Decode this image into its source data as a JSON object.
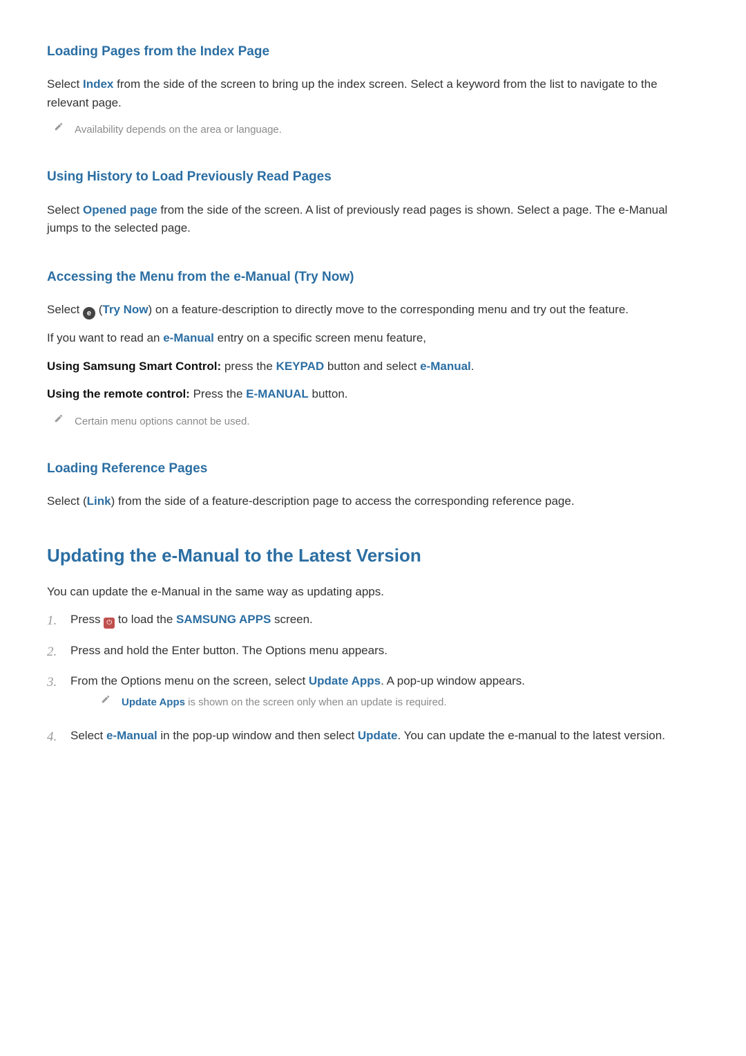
{
  "s1": {
    "heading": "Loading Pages from the Index Page",
    "p1a": "Select ",
    "hl": "Index",
    "p1b": " from the side of the screen to bring up the index screen. Select a keyword from the list to navigate to the relevant page.",
    "note": "Availability depends on the area or language."
  },
  "s2": {
    "heading": "Using History to Load Previously Read Pages",
    "p1a": "Select ",
    "hl": "Opened page",
    "p1b": " from the side of the screen. A list of previously read pages is shown. Select a page. The e-Manual jumps to the selected page."
  },
  "s3": {
    "heading": "Accessing the Menu from the e-Manual (Try Now)",
    "p1a": "Select ",
    "p1b": " (",
    "hl1": "Try Now",
    "p1c": ") on a feature-description to directly move to the corresponding menu and try out the feature.",
    "p2a": "If you want to read an ",
    "hl2": "e-Manual",
    "p2b": " entry on a specific screen menu feature,",
    "p3a": "Using Samsung Smart Control:",
    "p3b": " press the ",
    "hl3": "KEYPAD",
    "p3c": " button and select ",
    "hl4": "e-Manual",
    "p3d": ".",
    "p4a": "Using the remote control:",
    "p4b": " Press the ",
    "hl5": "E-MANUAL",
    "p4c": " button.",
    "note": "Certain menu options cannot be used."
  },
  "s4": {
    "heading": "Loading Reference Pages",
    "p1a": "Select    (",
    "hl": "Link",
    "p1b": ") from the side of a feature-description page to access the corresponding reference page."
  },
  "s5": {
    "heading": "Updating the e-Manual to the Latest Version",
    "intro": "You can update the e-Manual in the same way as updating apps.",
    "step1a": "Press ",
    "step1b": " to load the ",
    "step1hl": "SAMSUNG APPS",
    "step1c": " screen.",
    "step2": "Press and hold the Enter button. The Options menu appears.",
    "step3a": "From the Options menu on the screen, select ",
    "step3hl": "Update Apps",
    "step3b": ". A pop-up window appears.",
    "note3hl": "Update Apps",
    "note3b": " is shown on the screen only when an update is required.",
    "step4a": "Select ",
    "step4hl1": "e-Manual",
    "step4b": " in the pop-up window and then select ",
    "step4hl2": "Update",
    "step4c": ". You can update the e-manual to the latest version."
  },
  "icons": {
    "trynow": "e",
    "smart": "⏻"
  }
}
